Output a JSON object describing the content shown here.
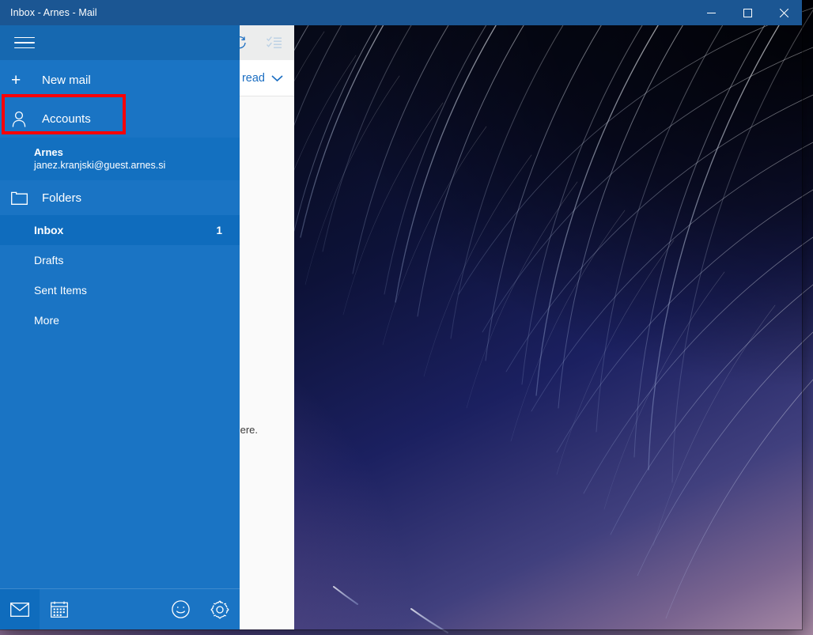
{
  "window": {
    "title": "Inbox - Arnes - Mail",
    "controls": {
      "minimize": "minimize-button",
      "maximize": "maximize-button",
      "close": "close-button"
    }
  },
  "toolbar": {
    "sync_icon": "sync-icon",
    "select_mode_icon": "select-mode-icon",
    "filter_label": "read",
    "filter_chevron": "chevron-down-icon"
  },
  "message_list": {
    "empty_text": "here."
  },
  "sidebar": {
    "hamburger": "hamburger-menu-icon",
    "new_mail": {
      "plus": "+",
      "label": "New mail"
    },
    "accounts": {
      "icon": "person-icon",
      "label": "Accounts"
    },
    "account": {
      "name": "Arnes",
      "email": "janez.kranjski@guest.arnes.si"
    },
    "folders_header": {
      "icon": "folder-icon",
      "label": "Folders"
    },
    "folders": [
      {
        "label": "Inbox",
        "count": "1",
        "selected": true
      },
      {
        "label": "Drafts",
        "count": "",
        "selected": false
      },
      {
        "label": "Sent Items",
        "count": "",
        "selected": false
      },
      {
        "label": "More",
        "count": "",
        "selected": false
      }
    ],
    "bottom_bar": [
      {
        "name": "mail-icon",
        "active": true
      },
      {
        "name": "calendar-icon",
        "active": false
      },
      {
        "name": "feedback-smiley-icon",
        "active": false
      },
      {
        "name": "settings-gear-icon",
        "active": false
      }
    ]
  },
  "annotation": {
    "highlight_target": "Accounts",
    "color": "#fb0007"
  },
  "colors": {
    "titlebar": "#1b5693",
    "sidebar": "#1a74c4",
    "sidebar_selected": "#0f6cbd",
    "accent_blue": "#1b6ec2",
    "toolbar_bg": "#eceded"
  }
}
